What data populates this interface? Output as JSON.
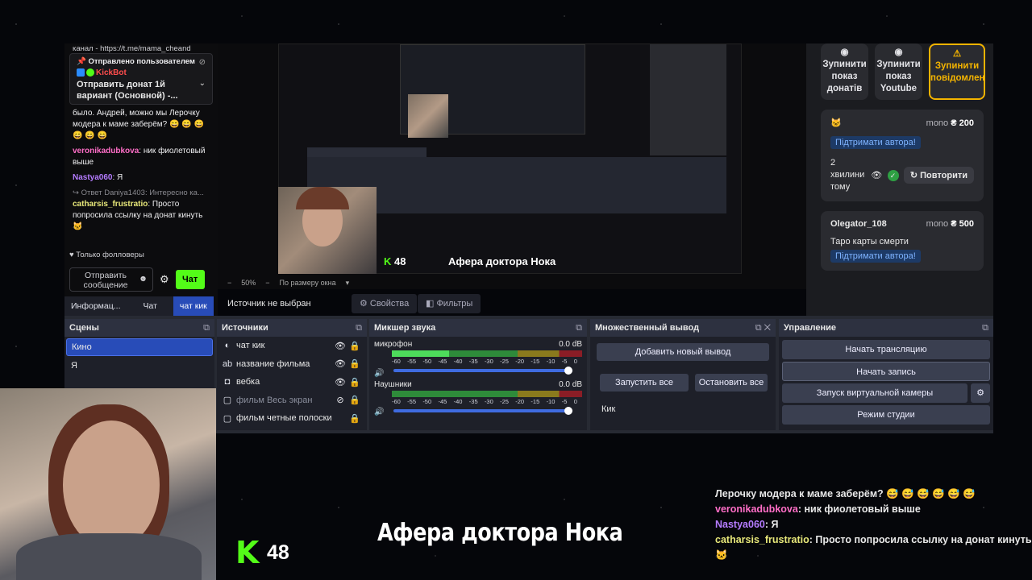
{
  "chat": {
    "top_cut": "канал - https://t.me/mama_cheand",
    "pinned_by": "📌 Отправлено пользователем",
    "pinned_user": "KickBot",
    "pinned_text": "Отправить донат 1й вариант (Основной) -...",
    "messages": [
      {
        "user": "",
        "text": "было. Андрей, можно мы Лерочку модера к маме заберём? 😄 😄 😄 😄 😄 😄"
      },
      {
        "user": "veronikadubkova",
        "text": ": ник фиолетовый выше"
      },
      {
        "user": "Nastya060",
        "text": ": Я"
      },
      {
        "reply": "↪ Ответ Daniya1403: Интересно ка...",
        "user": "catharsis_frustratio",
        "text": ": Просто попросила ссылку на донат кинуть 🐱"
      }
    ],
    "followers_only": "♥ Только фолловеры",
    "send_placeholder": "Отправить сообщение",
    "chat_button": "Чат"
  },
  "preview": {
    "zoom": "50%",
    "fit": "По размеру окна",
    "source_none": "Источник не выбран",
    "props": "⚙ Свойства",
    "filters": "◧ Фильтры"
  },
  "donation": {
    "stop_buttons": [
      "Зупинити показ донатів",
      "Зупинити показ Youtube",
      "Зупинити повідомлен"
    ],
    "cards": [
      {
        "icon": "🐱",
        "source": "mono",
        "amount": "₴ 200",
        "support": "Підтримати автора!",
        "time": "2 хвилини тому",
        "repeat": "Повторити"
      },
      {
        "user": "Olegator_108",
        "source": "mono",
        "amount": "₴ 500",
        "text": "Таро карты смерти",
        "support": "Підтримати автора!"
      }
    ]
  },
  "obs": {
    "tabs": [
      "Информац...",
      "Чат",
      "чат кик"
    ],
    "scenes_title": "Сцены",
    "scenes": [
      "Кино",
      "Я"
    ],
    "sources_title": "Источники",
    "sources": [
      "чат кик",
      "название фильма",
      "вебка",
      "фильм Весь экран",
      "фильм четные полоски"
    ],
    "mixer_title": "Микшер звука",
    "mixer": [
      {
        "name": "микрофон",
        "db": "0.0 dB"
      },
      {
        "name": "Наушники",
        "db": "0.0 dB"
      }
    ],
    "scale": [
      "-60",
      "-55",
      "-50",
      "-45",
      "-40",
      "-35",
      "-30",
      "-25",
      "-20",
      "-15",
      "-10",
      "-5",
      "0"
    ],
    "multi_title": "Множественный вывод",
    "multi_add": "Добавить новый вывод",
    "multi_start": "Запустить все",
    "multi_stop": "Остановить все",
    "multi_kick": "Кик",
    "control_title": "Управление",
    "controls": [
      "Начать трансляцию",
      "Начать запись",
      "Запуск виртуальной камеры",
      "Режим студии"
    ]
  },
  "overlay": {
    "chat": [
      {
        "user": "",
        "text": "Лерочку модера к маме заберём? 😅 😅 😅 😅 😅 😅"
      },
      {
        "user": "veronikadubkova",
        "text": ": ник фиолетовый выше"
      },
      {
        "user": "Nastya060",
        "text": ": Я"
      },
      {
        "user": "catharsis_frustratio",
        "text": ": Просто попросила ссылку на донат кинуть 🐱"
      }
    ],
    "movie_title": "Афера доктора Нока",
    "viewers": "48"
  }
}
